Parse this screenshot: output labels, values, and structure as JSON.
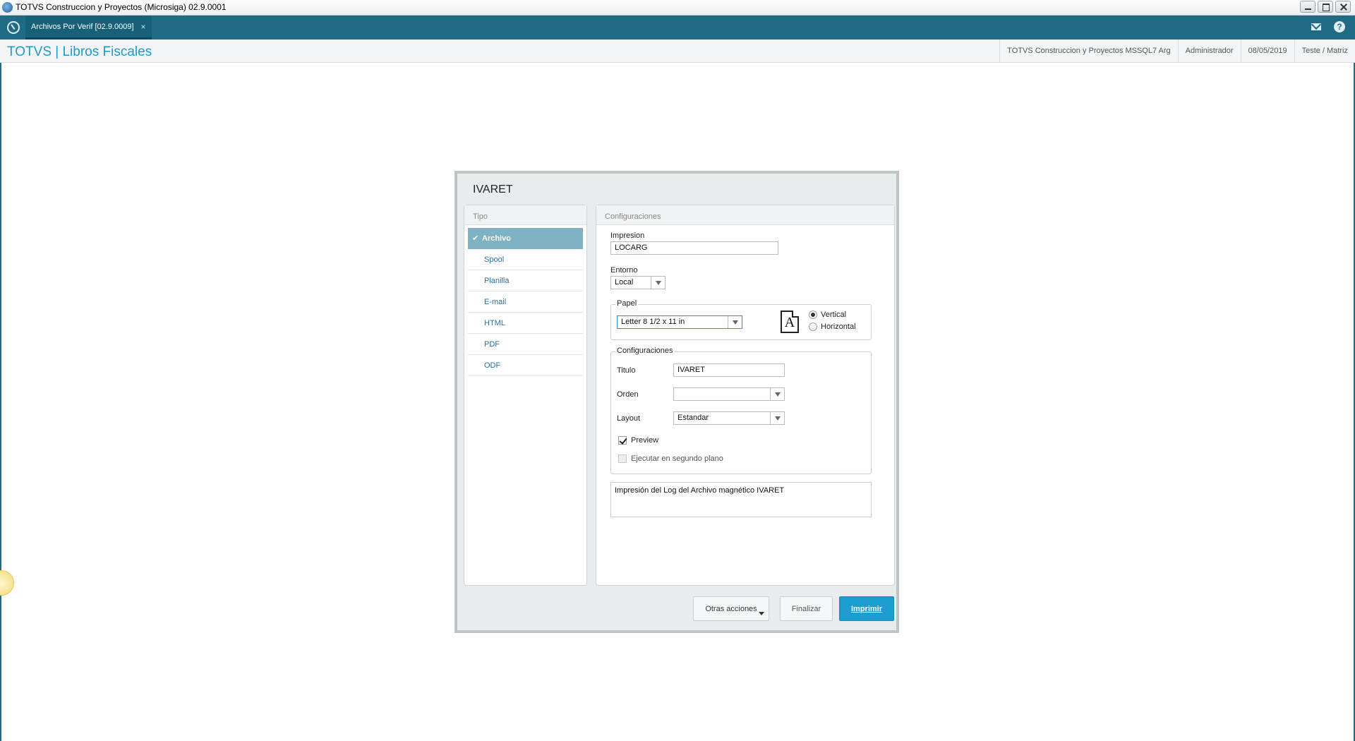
{
  "window": {
    "title": "TOTVS Construccion y Proyectos (Microsiga) 02.9.0001"
  },
  "tabbar": {
    "active_tab": "Archivos Por Verif [02.9.0009]",
    "close_glyph": "×"
  },
  "header": {
    "brand": "TOTVS | Libros Fiscales",
    "company": "TOTVS Construccion y Proyectos MSSQL7 Arg",
    "user": "Administrador",
    "date": "08/05/2019",
    "branch": "Teste / Matriz"
  },
  "dialog": {
    "title": "IVARET",
    "tipo": {
      "header": "Tipo",
      "items": [
        {
          "label": "Archivo",
          "selected": true
        },
        {
          "label": "Spool"
        },
        {
          "label": "Planilla"
        },
        {
          "label": "E-mail"
        },
        {
          "label": "HTML"
        },
        {
          "label": "PDF"
        },
        {
          "label": "ODF"
        }
      ]
    },
    "config": {
      "header": "Configuraciones",
      "impresion_label": "Impresion",
      "impresion_value": "LOCARG",
      "entorno_label": "Entorno",
      "entorno_value": "Local",
      "papel_legend": "Papel",
      "papel_value": "Letter 8 1/2 x 11 in",
      "paper_icon_letter": "A",
      "orientation": {
        "vertical": "Vertical",
        "horizontal": "Horizontal",
        "selected": "Vertical"
      },
      "config_legend": "Configuraciones",
      "titulo_label": "Titulo",
      "titulo_value": "IVARET",
      "orden_label": "Orden",
      "orden_value": "",
      "layout_label": "Layout",
      "layout_value": "Estandar",
      "preview_label": "Preview",
      "preview_checked": true,
      "segundo_plano_label": "Ejecutar en segundo plano",
      "segundo_plano_checked": false,
      "description": "Impresión del Log del Archivo magnético IVARET"
    },
    "buttons": {
      "otras": "Otras acciones",
      "finalizar": "Finalizar",
      "imprimir": "Imprimir"
    }
  }
}
